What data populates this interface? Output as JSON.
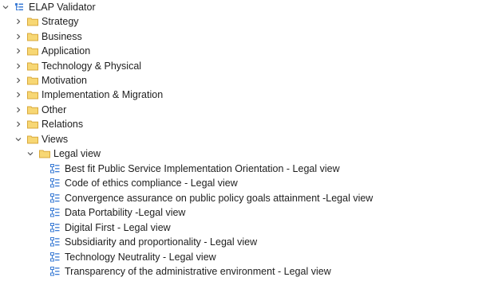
{
  "tree": {
    "root": {
      "label": "ELAP Validator",
      "expanded": true,
      "icon": "model-icon"
    },
    "folders": [
      {
        "label": "Strategy",
        "expanded": false,
        "icon": "folder-icon"
      },
      {
        "label": "Business",
        "expanded": false,
        "icon": "folder-icon"
      },
      {
        "label": "Application",
        "expanded": false,
        "icon": "folder-icon"
      },
      {
        "label": "Technology & Physical",
        "expanded": false,
        "icon": "folder-icon"
      },
      {
        "label": "Motivation",
        "expanded": false,
        "icon": "folder-icon"
      },
      {
        "label": "Implementation & Migration",
        "expanded": false,
        "icon": "folder-icon"
      },
      {
        "label": "Other",
        "expanded": false,
        "icon": "folder-icon"
      },
      {
        "label": "Relations",
        "expanded": false,
        "icon": "folder-icon"
      },
      {
        "label": "Views",
        "expanded": true,
        "icon": "folder-icon"
      }
    ],
    "subfolder": {
      "label": "Legal view",
      "expanded": true,
      "icon": "folder-icon"
    },
    "views": [
      {
        "label": "Best fit Public Service Implementation Orientation - Legal view",
        "icon": "diagram-icon"
      },
      {
        "label": "Code of ethics compliance - Legal view",
        "icon": "diagram-icon"
      },
      {
        "label": "Convergence assurance on public policy goals attainment -Legal view",
        "icon": "diagram-icon"
      },
      {
        "label": "Data Portability -Legal view",
        "icon": "diagram-icon"
      },
      {
        "label": "Digital First - Legal view",
        "icon": "diagram-icon"
      },
      {
        "label": "Subsidiarity and proportionality - Legal view",
        "icon": "diagram-icon"
      },
      {
        "label": "Technology Neutrality - Legal view",
        "icon": "diagram-icon"
      },
      {
        "label": "Transparency of the administrative environment - Legal view",
        "icon": "diagram-icon"
      }
    ]
  },
  "colors": {
    "text": "#1e1e1e",
    "folder_fill": "#f7d774",
    "diagram_icon": "#3a7bd5",
    "chevron": "#555555"
  }
}
